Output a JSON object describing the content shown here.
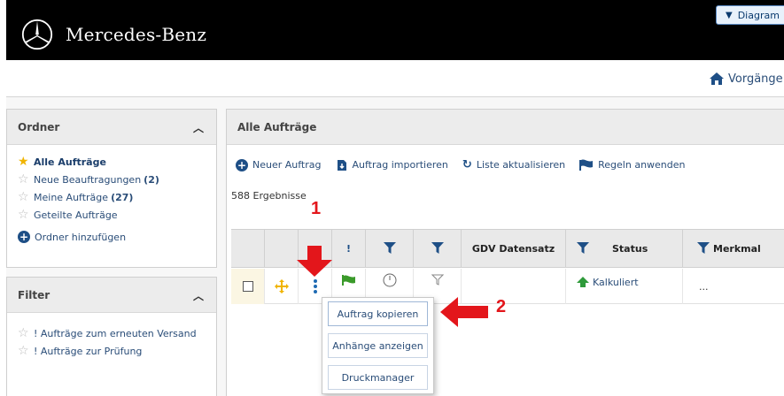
{
  "header": {
    "brand": "Mercedes-Benz",
    "diagram_button": "Diagram"
  },
  "nav": {
    "vorgaenge": "Vorgänge"
  },
  "ordner": {
    "title": "Ordner",
    "items": [
      {
        "label": "Alle Aufträge",
        "count": ""
      },
      {
        "label": "Neue Beauftragungen",
        "count": "(2)"
      },
      {
        "label": "Meine Aufträge",
        "count": "(27)"
      },
      {
        "label": "Geteilte Aufträge",
        "count": ""
      }
    ],
    "add_label": "Ordner hinzufügen"
  },
  "filter": {
    "title": "Filter",
    "items": [
      {
        "label": "! Aufträge zum erneuten Versand"
      },
      {
        "label": "! Aufträge zur Prüfung"
      }
    ]
  },
  "main": {
    "title": "Alle Aufträge",
    "toolbar": {
      "new": "Neuer Auftrag",
      "import": "Auftrag importieren",
      "refresh": "Liste aktualisieren",
      "rules": "Regeln anwenden"
    },
    "results": "588 Ergebnisse",
    "table": {
      "headers": {
        "excl": "!",
        "gdv": "GDV Datensatz",
        "status": "Status",
        "merkmal": "Merkmal"
      },
      "row": {
        "status": "Kalkuliert",
        "merkmal": "..."
      }
    }
  },
  "context_menu": {
    "items": [
      "Auftrag kopieren",
      "Anhänge anzeigen",
      "Druckmanager"
    ]
  },
  "annotations": {
    "step1": "1",
    "step2": "2"
  },
  "colors": {
    "accent": "#1e4f86",
    "annotation_red": "#e3161b",
    "header_bg": "#000000"
  }
}
